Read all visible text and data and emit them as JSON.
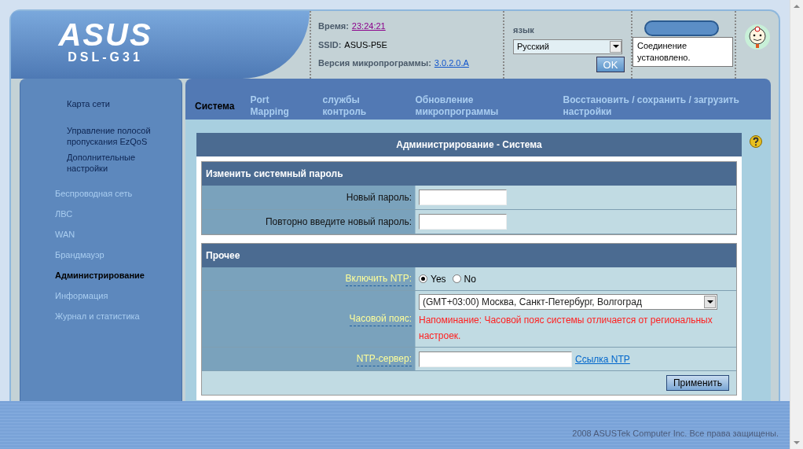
{
  "header": {
    "logo": "ASUS",
    "model": "DSL-G31",
    "info": [
      {
        "label": "Время:",
        "value": "23:24:21",
        "kind": "visited-link"
      },
      {
        "label": "SSID:",
        "value": "ASUS-P5E",
        "kind": "plain"
      },
      {
        "label": "Версия микропрограммы:",
        "value": "3.0.2.0.A",
        "kind": "link"
      }
    ],
    "language": {
      "label": "язык",
      "value": "Русский",
      "button": "OK"
    },
    "tooltip": "Соединение установлено."
  },
  "sidebar": [
    {
      "label": "Карта сети",
      "kind": "sub",
      "selected": false
    },
    {
      "label": "Управление полосой пропускания EzQoS",
      "kind": "sub",
      "selected": false
    },
    {
      "label": "Дополнительные настройки",
      "kind": "sub",
      "selected": false
    },
    {
      "label": "Беспроводная сеть",
      "kind": "main",
      "selected": false
    },
    {
      "label": "ЛВС",
      "kind": "main",
      "selected": false
    },
    {
      "label": "WAN",
      "kind": "main",
      "selected": false
    },
    {
      "label": "Брандмауэр",
      "kind": "main",
      "selected": false
    },
    {
      "label": "Администрирование",
      "kind": "main",
      "selected": true
    },
    {
      "label": "Информация",
      "kind": "main",
      "selected": false
    },
    {
      "label": "Журнал и статистика",
      "kind": "main",
      "selected": false
    }
  ],
  "tabs": [
    {
      "label": "Система",
      "selected": true
    },
    {
      "label": "Port Mapping",
      "selected": false
    },
    {
      "label": "службы контроль",
      "selected": false
    },
    {
      "label": "Обновление микропрограммы",
      "selected": false
    },
    {
      "label": "Восстановить / сохранить / загрузить настройки",
      "selected": false
    }
  ],
  "form": {
    "title": "Администрирование - Система",
    "sections": [
      {
        "title": "Изменить системный пароль",
        "rows": [
          {
            "kind": "password",
            "label": "Новый пароль:"
          },
          {
            "kind": "password",
            "label": "Повторно введите новый пароль:"
          }
        ]
      },
      {
        "title": "Прочее",
        "rows": [
          {
            "kind": "radio",
            "label": "Включить NTP:",
            "options": [
              {
                "label": "Yes",
                "selected": true
              },
              {
                "label": "No",
                "selected": false
              }
            ]
          },
          {
            "kind": "select",
            "label": "Часовой пояс:",
            "value": "(GMT+03:00) Москва, Санкт-Петербург, Волгоград",
            "note": "Напоминание: Часовой пояс системы отличается от региональных настроек."
          },
          {
            "kind": "text",
            "label": "NTP-сервер:",
            "link": "Ссылка NTP"
          }
        ]
      }
    ],
    "apply": "Применить"
  },
  "footer": "2008 ASUSTek Computer Inc. Все права защищены."
}
